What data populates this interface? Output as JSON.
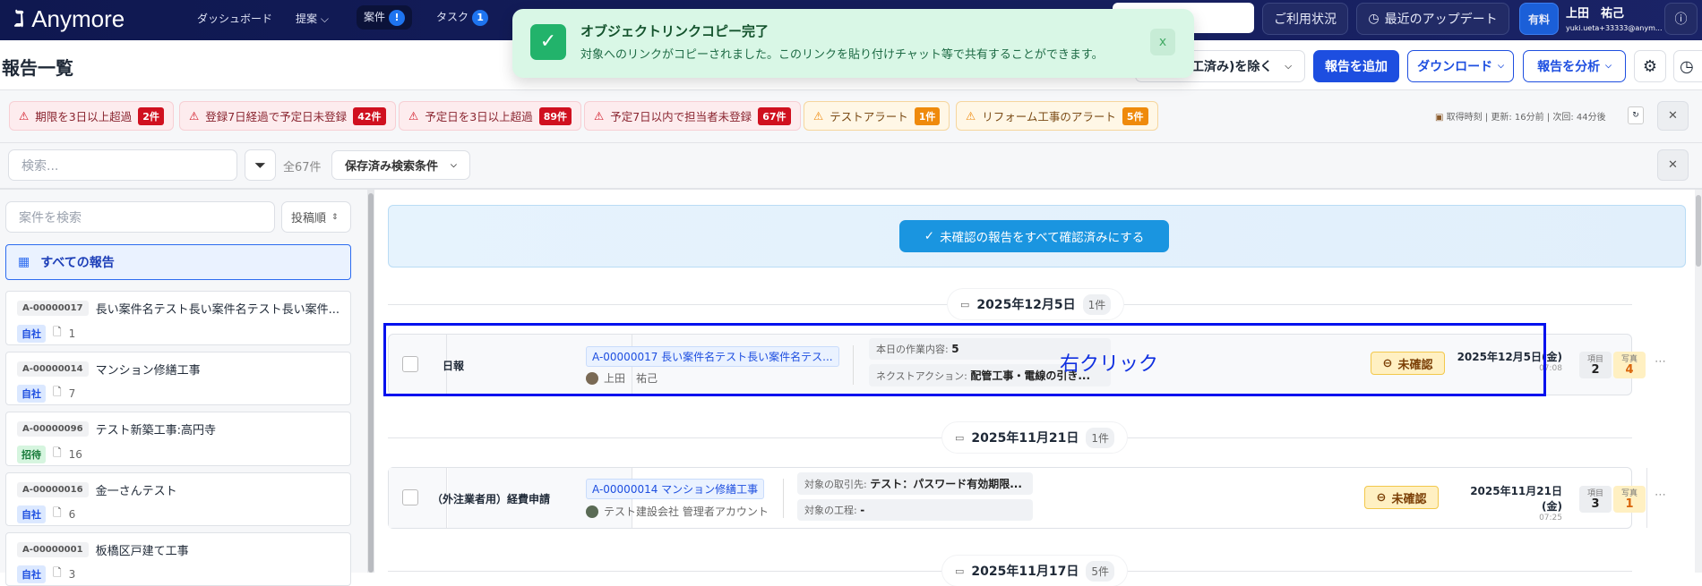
{
  "header": {
    "logo": "Anymore",
    "nav": [
      {
        "label": "ダッシュボード"
      },
      {
        "label": "提案"
      },
      {
        "label": "案件",
        "badge": "!"
      },
      {
        "label": "タスク",
        "badge": "1"
      }
    ],
    "usage": "ご利用状況",
    "updates": "最近のアップデート",
    "plan": "有料",
    "user_name": "上田　祐己",
    "user_email": "yuki.ueta+33333@anym..."
  },
  "toast": {
    "title": "オブジェクトリンクコピー完了",
    "message": "対象へのリンクがコピーされました。このリンクを貼り付けチャット等で共有することができます。",
    "close": "x"
  },
  "page": {
    "title": "報告一覧",
    "filter_select": "施工済み)を除く",
    "add": "報告を追加",
    "download": "ダウンロード",
    "analyze": "報告を分析"
  },
  "alerts": [
    {
      "label": "期限を3日以上超過",
      "count": "2件",
      "level": "red"
    },
    {
      "label": "登録7日経過で予定日未登録",
      "count": "42件",
      "level": "red"
    },
    {
      "label": "予定日を3日以上超過",
      "count": "89件",
      "level": "red"
    },
    {
      "label": "予定7日以内で担当者未登録",
      "count": "67件",
      "level": "red"
    },
    {
      "label": "テストアラート",
      "count": "1件",
      "level": "orange"
    },
    {
      "label": "リフォーム工事のアラート",
      "count": "5件",
      "level": "orange"
    }
  ],
  "fetch_info": "取得時刻 | 更新: 16分前 | 次回: 44分後",
  "search": {
    "placeholder": "検索...",
    "total": "全67件",
    "saved": "保存済み検索条件"
  },
  "sidebar": {
    "search_placeholder": "案件を検索",
    "sort": "投稿順",
    "all": "すべての報告",
    "projects": [
      {
        "code": "A-00000017",
        "name": "長い案件名テスト長い案件名テスト長い案件...",
        "tag": "自社",
        "count": "1"
      },
      {
        "code": "A-00000014",
        "name": "マンション修繕工事",
        "tag": "自社",
        "count": "7"
      },
      {
        "code": "A-00000096",
        "name": "テスト新築工事:高円寺",
        "tag": "招待",
        "count": "16"
      },
      {
        "code": "A-00000016",
        "name": "金一さんテスト",
        "tag": "自社",
        "count": "6"
      },
      {
        "code": "A-00000001",
        "name": "板橋区戸建て工事",
        "tag": "自社",
        "count": "3"
      }
    ]
  },
  "main": {
    "confirm_all": "未確認の報告をすべて確認済みにする",
    "groups": [
      {
        "date": "2025年12月5日",
        "count": "1件"
      },
      {
        "date": "2025年11月21日",
        "count": "1件"
      },
      {
        "date": "2025年11月17日",
        "count": "5件"
      }
    ],
    "reports": [
      {
        "type": "日報",
        "project": "A-00000017 長い案件名テスト長い案件名テス...",
        "author": "上田　祐己",
        "k1": "本日の作業内容:",
        "v1": "5",
        "k2": "ネクストアクション:",
        "v2": "配管工事・電線の引き...",
        "status": "未確認",
        "date": "2025年12月5日(金)",
        "time": "07:08",
        "items_label": "項目",
        "items": "2",
        "photos_label": "写真",
        "photos": "4"
      },
      {
        "type": "（外注業者用）経費申請",
        "project": "A-00000014 マンション修繕工事",
        "author": "テスト建設会社 管理者アカウント",
        "k1": "対象の取引先:",
        "v1": "テスト：パスワード有効期限...",
        "k2": "対象の工程:",
        "v2": "-",
        "status": "未確認",
        "date": "2025年11月21日(金)",
        "time": "07:25",
        "items_label": "項目",
        "items": "3",
        "photos_label": "写真",
        "photos": "1"
      }
    ]
  },
  "annotation": "右クリック"
}
